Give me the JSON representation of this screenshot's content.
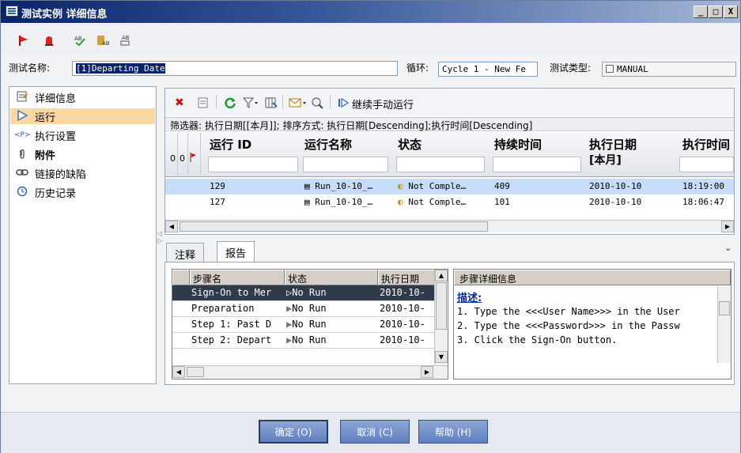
{
  "window": {
    "title": "测试实例 详细信息",
    "controls": {
      "minimize": "_",
      "maximize": "□",
      "close": "X"
    }
  },
  "colors": {
    "accent": "#0a246a",
    "nav_active": "#f8d9a4",
    "row_selected": "#c7dcf6",
    "step_selected": "#2f3a4a"
  },
  "header": {
    "test_name_label": "测试名称:",
    "test_name_value": "[1]Departing Date",
    "cycle_label": "循环:",
    "cycle_value": "Cycle 1 - New Fe",
    "test_type_label": "测试类型:",
    "test_type_value": "MANUAL"
  },
  "nav": {
    "items": [
      {
        "label": "详细信息",
        "icon": "details-icon"
      },
      {
        "label": "运行",
        "icon": "run-icon"
      },
      {
        "label": "执行设置",
        "icon": "params-icon"
      },
      {
        "label": "附件",
        "icon": "attachment-icon"
      },
      {
        "label": "链接的缺陷",
        "icon": "link-icon"
      },
      {
        "label": "历史记录",
        "icon": "history-icon"
      }
    ]
  },
  "runs_toolbar": {
    "continue_label": "继续手动运行"
  },
  "filter_text": "筛选器:  执行日期[[本月]];  排序方式:  执行日期[Descending];执行时间[Descending]",
  "grid": {
    "columns": [
      "运行 ID",
      "运行名称",
      "状态",
      "持续时间",
      "执行日期",
      "[本月]",
      "执行时间"
    ],
    "rows": [
      {
        "id": "129",
        "name": "Run_10-10_…",
        "status": "Not Comple…",
        "duration": "409",
        "date": "2010-10-10",
        "time": "18:19:00"
      },
      {
        "id": "127",
        "name": "Run_10-10_…",
        "status": "Not Comple…",
        "duration": "101",
        "date": "2010-10-10",
        "time": "18:06:47"
      }
    ]
  },
  "bottom_tabs": {
    "notes": "注释",
    "report": "报告"
  },
  "steps": {
    "headers": [
      "步骤名",
      "状态",
      "执行日期"
    ],
    "rows": [
      {
        "name": "Sign-On to Mer",
        "status": "No Run",
        "date": "2010-10-"
      },
      {
        "name": "Preparation",
        "status": "No Run",
        "date": "2010-10-"
      },
      {
        "name": "Step 1: Past D",
        "status": "No Run",
        "date": "2010-10-"
      },
      {
        "name": "Step 2: Depart",
        "status": "No Run",
        "date": "2010-10-"
      }
    ]
  },
  "step_details": {
    "header": "步骤详细信息",
    "desc_label": "描述:",
    "lines": [
      "1. Type the <<<User Name>>> in the User",
      "2. Type the <<<Password>>> in the Passw",
      "3. Click the Sign-On button."
    ]
  },
  "footer": {
    "ok": "确定 (O)",
    "cancel": "取消 (C)",
    "help": "帮助 (H)"
  }
}
